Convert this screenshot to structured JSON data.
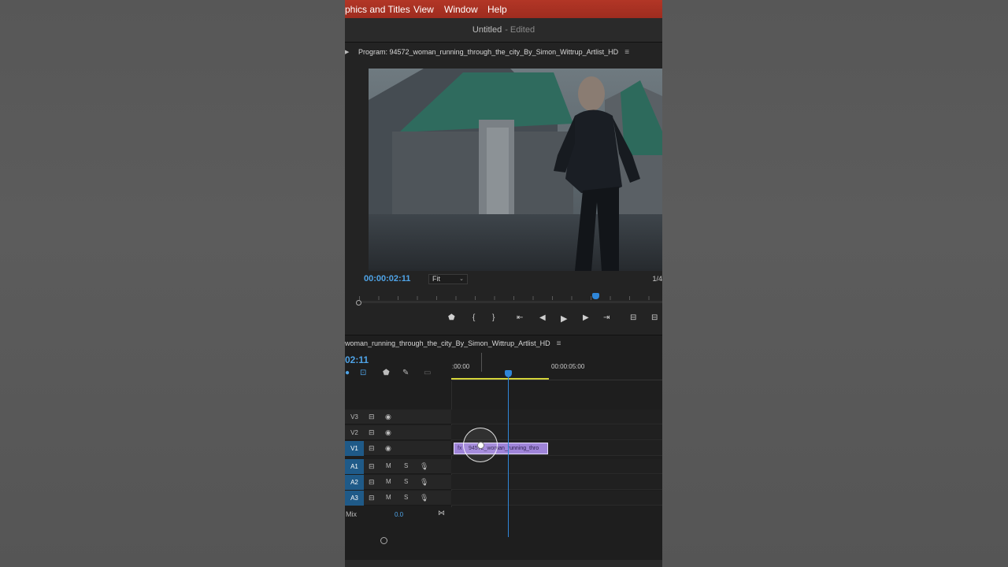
{
  "menubar": {
    "items": [
      "phics and Titles",
      "View",
      "Window",
      "Help"
    ]
  },
  "titlebar": {
    "document": "Untitled",
    "status": "- Edited"
  },
  "program": {
    "header": "Program: 94572_woman_running_through_the_city_By_Simon_Wittrup_Artlist_HD",
    "timecode": "00:00:02:11",
    "fit": "Fit",
    "resolution": "1/4",
    "playhead_fraction": 0.78
  },
  "transport": {
    "icons": [
      "marker-icon",
      "mark-in-icon",
      "mark-out-icon",
      "go-to-in-icon",
      "step-back-icon",
      "play-icon",
      "step-forward-icon",
      "go-to-out-icon",
      "lift-icon",
      "extract-icon"
    ]
  },
  "timeline": {
    "sequence_name": "woman_running_through_the_city_By_Simon_Wittrup_Artlist_HD",
    "timecode": "02:11",
    "ruler_start": ":00:00",
    "ruler_mark": "00:00:05:00",
    "tracks": [
      {
        "name": "V3",
        "active": false,
        "type": "video"
      },
      {
        "name": "V2",
        "active": false,
        "type": "video"
      },
      {
        "name": "V1",
        "active": true,
        "type": "video"
      },
      {
        "name": "A1",
        "active": true,
        "type": "audio"
      },
      {
        "name": "A2",
        "active": true,
        "type": "audio"
      },
      {
        "name": "A3",
        "active": true,
        "type": "audio"
      }
    ],
    "audio_buttons": {
      "mute": "M",
      "solo": "S"
    },
    "clip": {
      "fx_label": "fx",
      "label": "94572_woman_running_thro"
    },
    "mix": {
      "label": "Mix",
      "value": "0.0"
    }
  },
  "colors": {
    "menubar": "#a8301f",
    "accent": "#4fa3e6",
    "clip": "#9f84d9",
    "workarea": "#d4d43a"
  }
}
